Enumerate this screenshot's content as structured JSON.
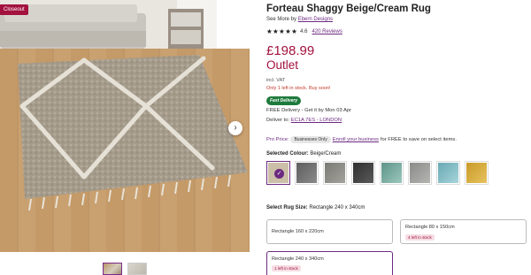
{
  "gallery": {
    "badge": "Closeout",
    "next_icon": "chevron-right-icon",
    "thumbnails": [
      "rug-thumb-1",
      "rug-thumb-2"
    ]
  },
  "product": {
    "title": "Forteau Shaggy Beige/Cream Rug",
    "see_more_prefix": "See More by",
    "brand": "Ebern Designs",
    "stars_icon": "star-rating-icon",
    "rating": "4.6",
    "reviews": "420 Reviews",
    "price": "£198.99",
    "outlet": "Outlet",
    "vat": "incl. VAT",
    "stock_notice": "Only 1 left in stock. Buy soon!",
    "fast_delivery": "Fast Delivery",
    "free_delivery": "FREE Delivery - Get it by Mon 03 Apr",
    "deliver_to_label": "Deliver to:",
    "deliver_to_location": "EC1A 7ES - LONDON",
    "pro_price_label": "Pro Price:",
    "businesses_only": "Businesses Only",
    "enroll_link": "Enroll your business",
    "enroll_suffix": "for FREE to save on select items."
  },
  "colour": {
    "label": "Selected Colour:",
    "value": "Beige/Cream",
    "swatches": [
      {
        "color": "#cbbfa8",
        "selected": true
      },
      {
        "color": "#6e6e6e"
      },
      {
        "color": "#8a8a85"
      },
      {
        "color": "#3f3f3f"
      },
      {
        "color": "#6fa59a"
      },
      {
        "color": "#9a9a98"
      },
      {
        "color": "#7fb9c2"
      },
      {
        "color": "#d3a83a"
      }
    ],
    "accent": "#6b2a80",
    "price_color": "#a3123f"
  },
  "size": {
    "label": "Select Rug Size:",
    "value": "Rectangle 240 x 340cm",
    "options": [
      {
        "name": "Rectangle 160 x 220cm",
        "stock": ""
      },
      {
        "name": "Rectangle 80 x 150cm",
        "stock": "4 left in stock"
      },
      {
        "name": "Rectangle 240 x 340cm",
        "stock": "1 left in stock",
        "selected": true
      }
    ]
  }
}
